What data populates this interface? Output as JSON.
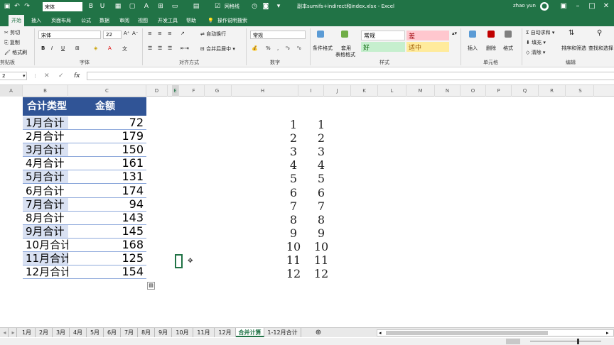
{
  "app": {
    "doc_title": "副本sumifs+indirect和index.xlsx - Excel",
    "user": "zhao yun",
    "quick_font": "宋体",
    "grid_toggle": "网格线"
  },
  "tabs": [
    "开始",
    "插入",
    "页面布局",
    "公式",
    "数据",
    "审阅",
    "视图",
    "开发工具",
    "帮助"
  ],
  "tell_me": "操作说明搜索",
  "ribbon": {
    "clipboard": {
      "cut": "剪切",
      "copy": "复制",
      "painter": "格式刷",
      "label": "剪贴板"
    },
    "font": {
      "name": "宋体",
      "size": "22",
      "label": "字体"
    },
    "alignment": {
      "wrap": "自动换行",
      "merge": "合并后居中",
      "label": "对齐方式"
    },
    "number": {
      "format": "常规",
      "label": "数字"
    },
    "styles": {
      "cond": "条件格式",
      "table": "套用",
      "table2": "表格格式",
      "normal": "常规",
      "bad": "差",
      "good": "好",
      "neutral": "适中",
      "label": "样式"
    },
    "cells": {
      "insert": "插入",
      "delete": "删除",
      "format": "格式",
      "label": "单元格"
    },
    "editing": {
      "autosum": "自动求和",
      "fill": "填充",
      "clear": "清除",
      "sort": "排序和筛选",
      "find": "查找和选择",
      "label": "编辑"
    }
  },
  "formula_bar": {
    "name_box": "2",
    "fx": "fx",
    "content": ""
  },
  "columns": [
    "A",
    "B",
    "C",
    "D",
    "E",
    "F",
    "G",
    "H",
    "I",
    "J",
    "K",
    "L",
    "M",
    "N",
    "O",
    "P",
    "Q",
    "R",
    "S"
  ],
  "table": {
    "header_type": "合计类型",
    "header_amount": "金额",
    "rows": [
      {
        "type": "1月合计",
        "amount": "72"
      },
      {
        "type": "2月合计",
        "amount": "179"
      },
      {
        "type": "3月合计",
        "amount": "150"
      },
      {
        "type": "4月合计",
        "amount": "161"
      },
      {
        "type": "5月合计",
        "amount": "131"
      },
      {
        "type": "6月合计",
        "amount": "174"
      },
      {
        "type": "7月合计",
        "amount": "94"
      },
      {
        "type": "8月合计",
        "amount": "143"
      },
      {
        "type": "9月合计",
        "amount": "145"
      },
      {
        "type": "10月合计",
        "amount": "168"
      },
      {
        "type": "11月合计",
        "amount": "125"
      },
      {
        "type": "12月合计",
        "amount": "154"
      }
    ]
  },
  "number_cols": {
    "h": [
      "1",
      "2",
      "3",
      "4",
      "5",
      "6",
      "7",
      "8",
      "9",
      "10",
      "11",
      "12"
    ],
    "i": [
      "1",
      "2",
      "3",
      "4",
      "5",
      "6",
      "7",
      "8",
      "9",
      "10",
      "11",
      "12"
    ]
  },
  "sheet_tabs": [
    "1月",
    "2月",
    "3月",
    "4月",
    "5月",
    "6月",
    "7月",
    "8月",
    "9月",
    "10月",
    "11月",
    "12月",
    "合并计算",
    "1-12月合计"
  ],
  "active_sheet": "合并计算",
  "colors": {
    "brand": "#217346",
    "header_fill": "#305496",
    "band_fill": "#d9e1f2"
  }
}
